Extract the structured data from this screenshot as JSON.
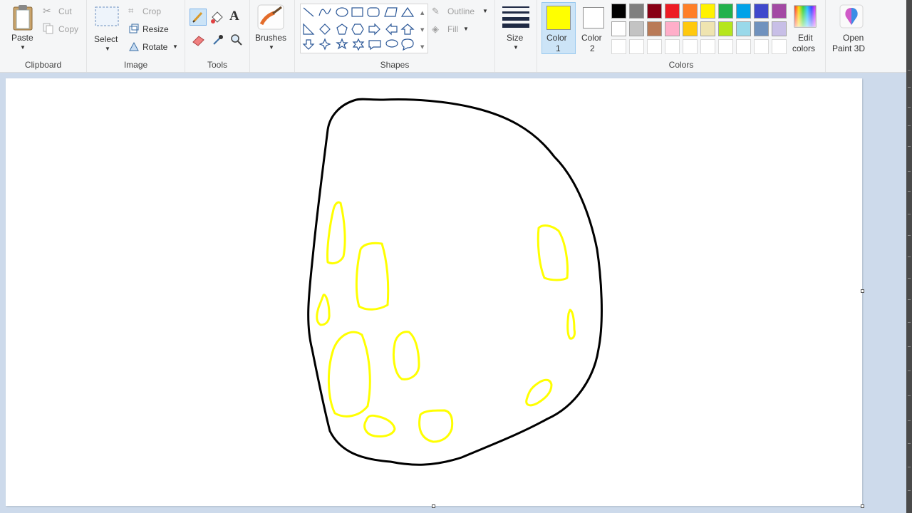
{
  "ribbon": {
    "clipboard": {
      "label": "Clipboard",
      "paste": "Paste",
      "cut": "Cut",
      "copy": "Copy"
    },
    "image": {
      "label": "Image",
      "select": "Select",
      "crop": "Crop",
      "resize": "Resize",
      "rotate": "Rotate"
    },
    "tools": {
      "label": "Tools"
    },
    "brushes": {
      "label": "Brushes"
    },
    "shapes": {
      "label": "Shapes",
      "outline": "Outline",
      "fill": "Fill"
    },
    "size": {
      "label": "Size"
    },
    "colors": {
      "label": "Colors",
      "color1_a": "Color",
      "color1_b": "1",
      "color2_a": "Color",
      "color2_b": "2",
      "color1": "#ffff00",
      "color2": "#ffffff",
      "edit_a": "Edit",
      "edit_b": "colors",
      "palette_row1": [
        "#000000",
        "#7f7f7f",
        "#880015",
        "#ed1c24",
        "#ff7f27",
        "#fff200",
        "#22b14c",
        "#00a2e8",
        "#3f48cc",
        "#a349a4"
      ],
      "palette_row2": [
        "#ffffff",
        "#c3c3c3",
        "#b97a57",
        "#ffaec9",
        "#ffc90e",
        "#efe4b0",
        "#b5e61d",
        "#99d9ea",
        "#7092be",
        "#c8bfe7"
      ]
    },
    "paint3d": {
      "line1": "Open",
      "line2": "Paint 3D"
    }
  },
  "drawing": {
    "outline_color": "#000000",
    "spot_color": "#ffff00"
  }
}
